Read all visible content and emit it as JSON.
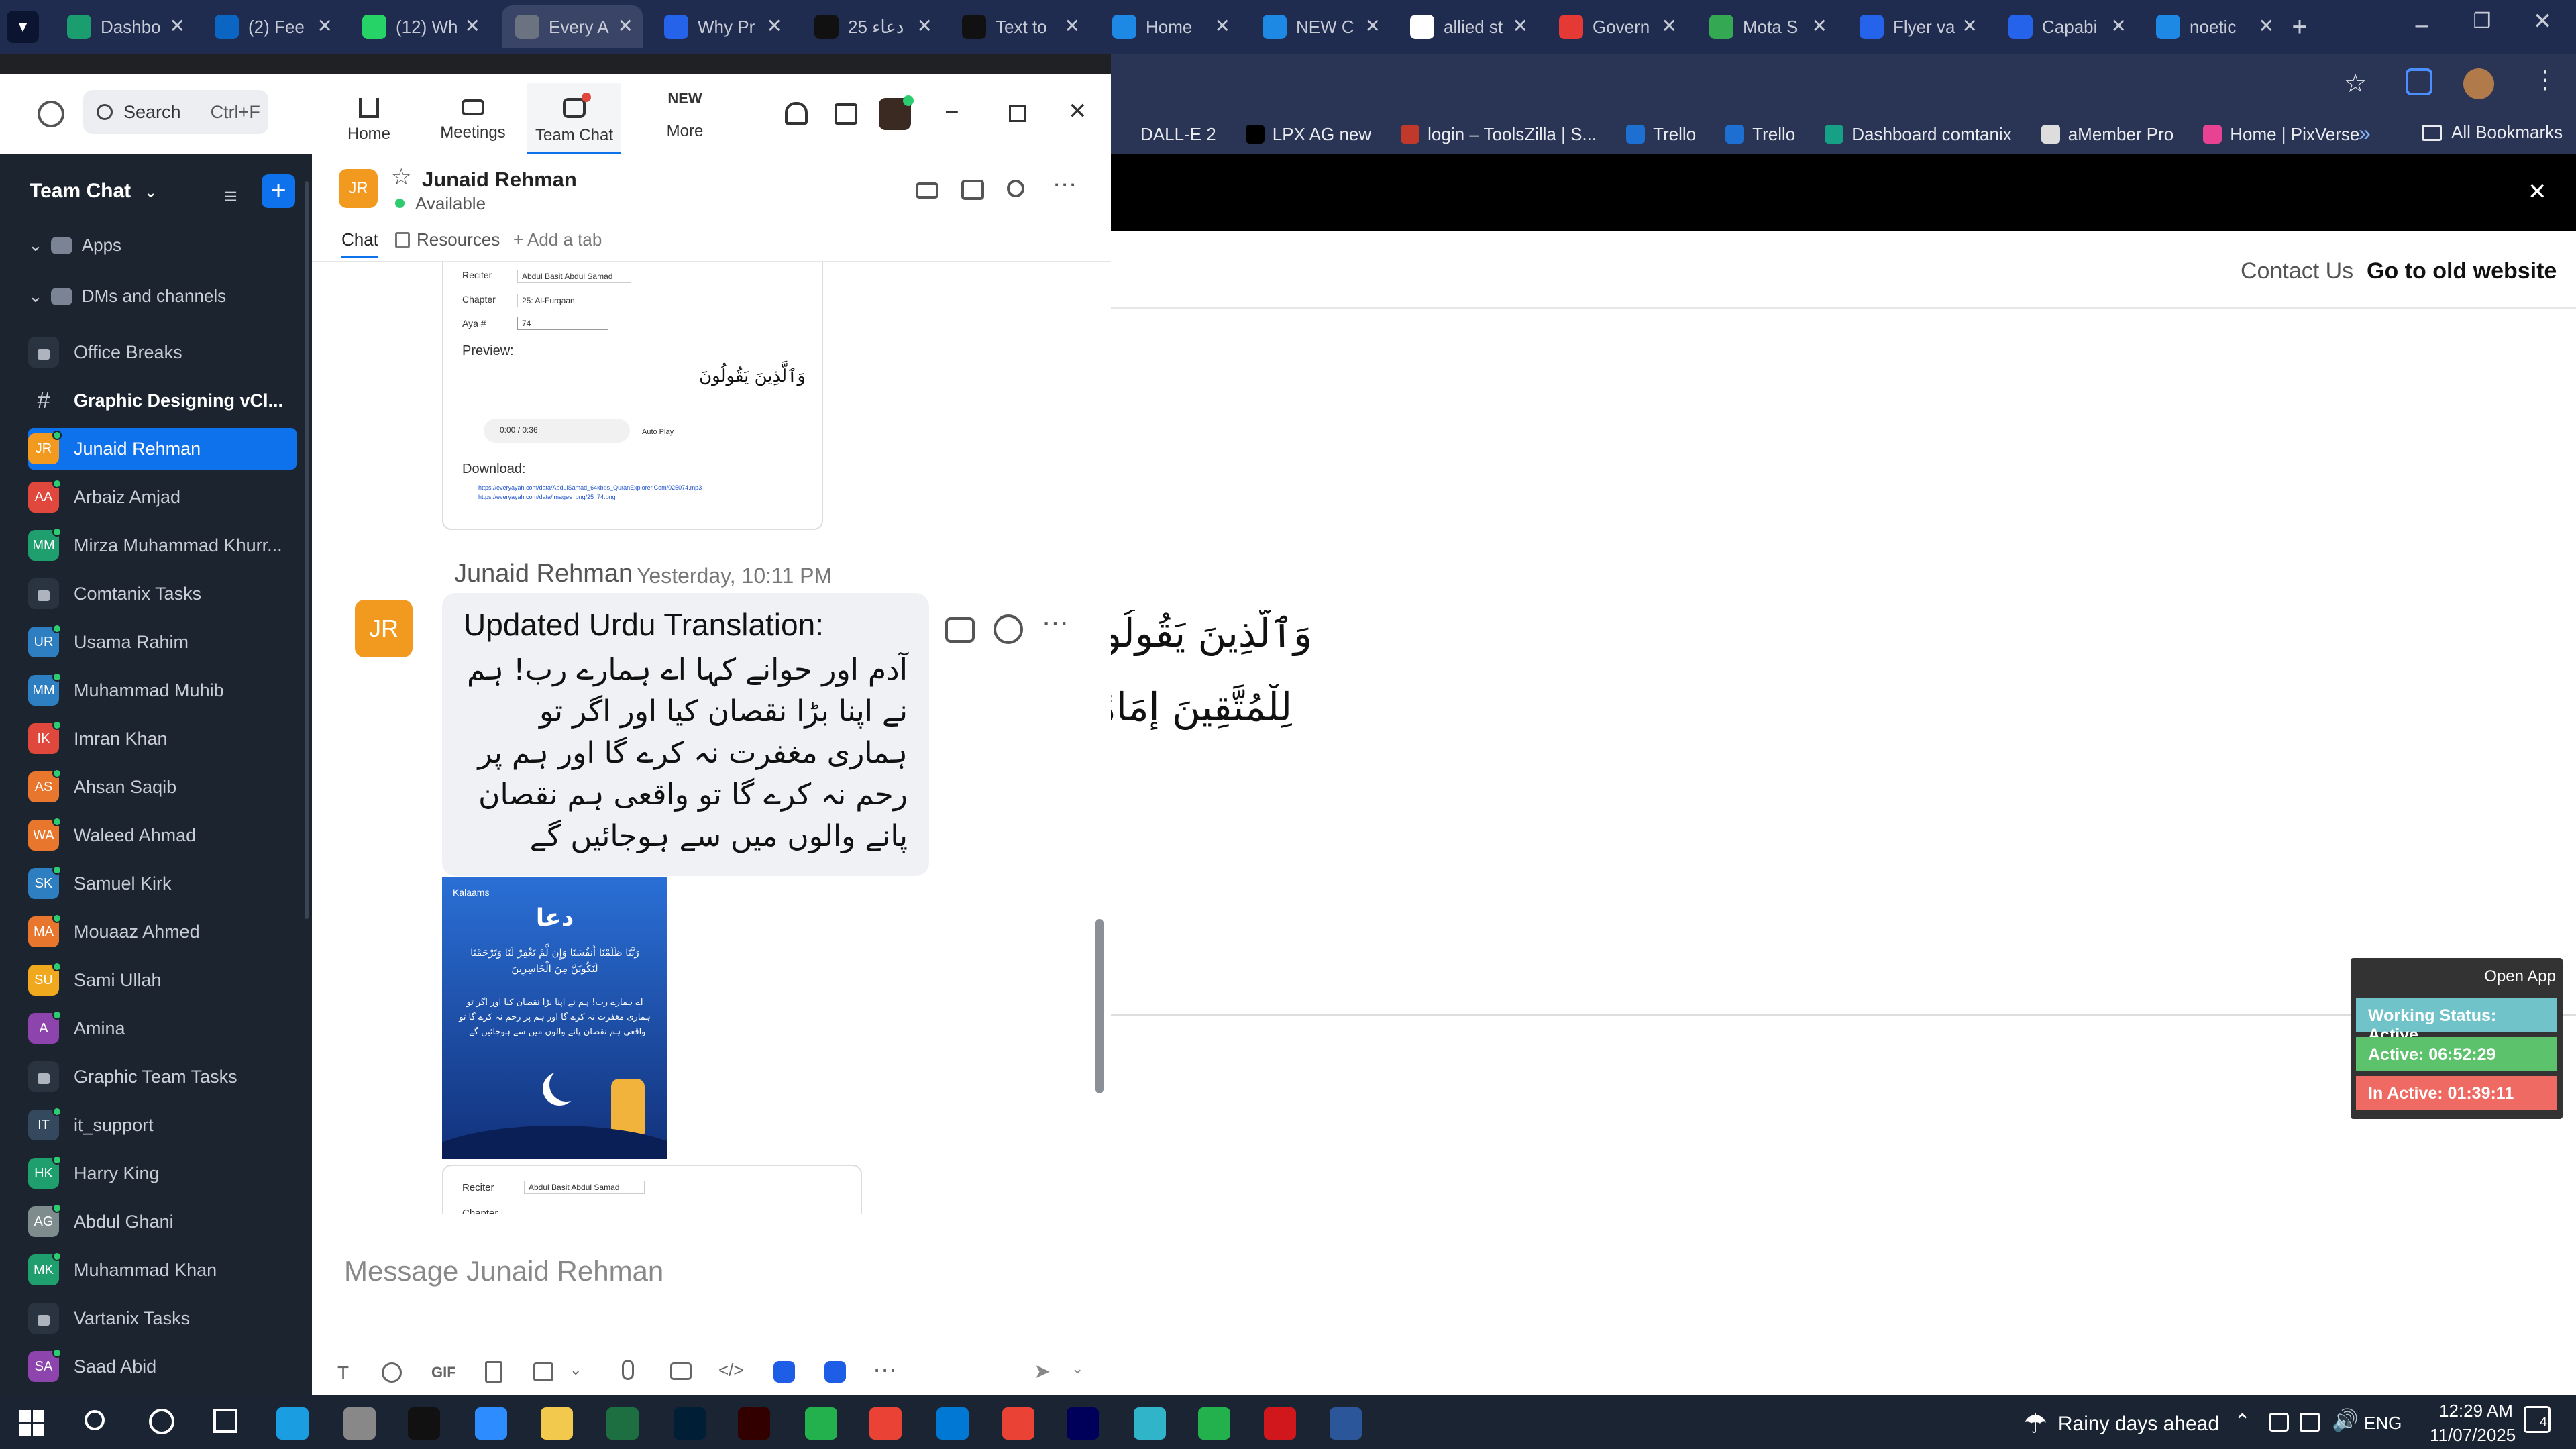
{
  "browser": {
    "tabs": [
      {
        "label": "Dashbo",
        "color": "#1a9e6f"
      },
      {
        "label": "(2) Fee",
        "color": "#0a66c2"
      },
      {
        "label": "(12) Wh",
        "color": "#25d366"
      },
      {
        "label": "Every A",
        "color": "#6b7280"
      },
      {
        "label": "Why Pr",
        "color": "#2563eb"
      },
      {
        "label": "25 دعاء",
        "color": "#111111"
      },
      {
        "label": "Text to",
        "color": "#111111"
      },
      {
        "label": "Home",
        "color": "#1e88e5"
      },
      {
        "label": "NEW C",
        "color": "#1e88e5"
      },
      {
        "label": "allied st",
        "color": "#ffffff"
      },
      {
        "label": "Govern",
        "color": "#e53935"
      },
      {
        "label": "Mota S",
        "color": "#34a853"
      },
      {
        "label": "Flyer va",
        "color": "#2563eb"
      },
      {
        "label": "Capabi",
        "color": "#2563eb"
      },
      {
        "label": "noetic",
        "color": "#1e88e5"
      }
    ],
    "bookmarks": [
      "DALL-E 2",
      "LPX AG new",
      "login – ToolsZilla | S...",
      "Trello",
      "Trello",
      "Dashboard comtanix",
      "aMember Pro",
      "Home | PixVerse"
    ],
    "all_bookmarks": "All Bookmarks",
    "site_nav": {
      "contact": "Contact Us",
      "old_site": "Go to old website"
    },
    "arabic_text_line1": "وَٱلَّذِينَ يَقُولُونَ",
    "arabic_text_line2": "لِلْمُتَّقِينَ إِمَامًا"
  },
  "zoom": {
    "search_placeholder": "Search",
    "search_shortcut": "Ctrl+F",
    "nav": {
      "home": "Home",
      "meetings": "Meetings",
      "team_chat": "Team Chat",
      "more": "More",
      "new_badge": "NEW"
    },
    "sidebar": {
      "title": "Team Chat",
      "apps": "Apps",
      "dms": "DMs and channels",
      "items": [
        {
          "name": "Office Breaks",
          "initials": "",
          "color": "",
          "kind": "lock"
        },
        {
          "name": "Graphic Designing vCl...",
          "initials": "#",
          "color": "",
          "kind": "hash"
        },
        {
          "name": "Junaid Rehman",
          "initials": "JR",
          "color": "#f29a1f",
          "kind": "user"
        },
        {
          "name": "Arbaiz Amjad",
          "initials": "AA",
          "color": "#e0483e",
          "kind": "user"
        },
        {
          "name": "Mirza Muhammad Khurr...",
          "initials": "MM",
          "color": "#1f9e6e",
          "kind": "user"
        },
        {
          "name": "Comtanix Tasks",
          "initials": "",
          "color": "",
          "kind": "lock"
        },
        {
          "name": "Usama Rahim",
          "initials": "UR",
          "color": "#2d7fc1",
          "kind": "user"
        },
        {
          "name": "Muhammad Muhib",
          "initials": "MM",
          "color": "#2d7fc1",
          "kind": "user"
        },
        {
          "name": "Imran Khan",
          "initials": "IK",
          "color": "#e0483e",
          "kind": "user"
        },
        {
          "name": "Ahsan Saqib",
          "initials": "AS",
          "color": "#e8762c",
          "kind": "user"
        },
        {
          "name": "Waleed Ahmad",
          "initials": "WA",
          "color": "#e8762c",
          "kind": "user"
        },
        {
          "name": "Samuel Kirk",
          "initials": "SK",
          "color": "#2d7fc1",
          "kind": "user"
        },
        {
          "name": "Mouaaz Ahmed",
          "initials": "MA",
          "color": "#e8762c",
          "kind": "user"
        },
        {
          "name": "Sami Ullah",
          "initials": "SU",
          "color": "#f0a81f",
          "kind": "user"
        },
        {
          "name": "Amina",
          "initials": "A",
          "color": "#8e44ad",
          "kind": "user"
        },
        {
          "name": "Graphic Team Tasks",
          "initials": "",
          "color": "",
          "kind": "lock"
        },
        {
          "name": "it_support",
          "initials": "IT",
          "color": "#34495e",
          "kind": "user"
        },
        {
          "name": "Harry King",
          "initials": "HK",
          "color": "#1f9e6e",
          "kind": "user"
        },
        {
          "name": "Abdul Ghani",
          "initials": "AG",
          "color": "#7f8c8d",
          "kind": "user"
        },
        {
          "name": "Muhammad Khan",
          "initials": "MK",
          "color": "#1f9e6e",
          "kind": "user"
        },
        {
          "name": "Vartanix Tasks",
          "initials": "",
          "color": "",
          "kind": "lock"
        },
        {
          "name": "Saad Abid",
          "initials": "SA",
          "color": "#8e44ad",
          "kind": "user"
        }
      ]
    },
    "chat": {
      "contact_name": "Junaid Rehman",
      "contact_initials": "JR",
      "status": "Available",
      "tabs": {
        "chat": "Chat",
        "resources": "Resources",
        "add_tab": "Add a tab"
      },
      "shot1": {
        "reciter_label": "Reciter",
        "reciter_value": "Abdul Basit Abdul Samad",
        "chapter_label": "Chapter",
        "chapter_value": "25: Al-Furqaan",
        "aya_label": "Aya #",
        "aya_value": "74",
        "preview": "Preview:",
        "audio_time": "0:00 / 0:36",
        "autoplay": "Auto Play",
        "download": "Download:",
        "link1": "https://everyayah.com/data/AbdulSamad_64kbps_QuranExplorer.Com/025074.mp3",
        "link2": "https://everyayah.com/data/images_png/25_74.png"
      },
      "message": {
        "sender": "Junaid Rehman",
        "time": "Yesterday, 10:11 PM",
        "title": "Updated Urdu Translation:",
        "body": "آدم اور حوانے کہا اے ہمارے رب! ہم نے اپنا بڑا نقصان کیا اور اگر تو ہماری مغفرت نہ کرے گا اور ہم پر رحم نہ کرے گا تو واقعی ہم نقصان پانے والوں میں سے ہوجائیں گے"
      },
      "poster": {
        "brand": "Kalaams",
        "title": "دعا",
        "arabic": "رَبَّنَا ظَلَمْنَا أَنفُسَنَا وَإِن لَّمْ تَغْفِرْ لَنَا وَتَرْحَمْنَا لَنَكُونَنَّ مِنَ الْخَاسِرِينَ",
        "urdu": "اے ہمارے رب! ہم نے اپنا بڑا نقصان کیا اور اگر تو ہماری مغفرت نہ کرے گا اور ہم پر رحم نہ کرے گا تو واقعی ہم نقصان پانے والوں میں سے ہوجائیں گے۔"
      },
      "shot2": {
        "reciter_label": "Reciter",
        "reciter_value": "Abdul Basit Abdul Samad",
        "chapter_label": "Chapter"
      },
      "composer_placeholder": "Message Junaid Rehman",
      "gif": "GIF"
    }
  },
  "widget": {
    "open_app": "Open App",
    "working": "Working Status: Active",
    "active": "Active: 06:52:29",
    "inactive": "In Active: 01:39:11"
  },
  "taskbar": {
    "weather": "Rainy days ahead",
    "lang": "ENG",
    "time": "12:29 AM",
    "date": "11/07/2025",
    "notif_count": "4"
  }
}
